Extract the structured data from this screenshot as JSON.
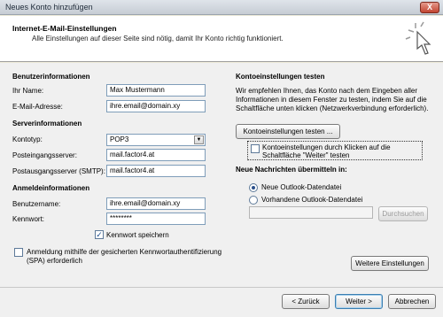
{
  "window": {
    "title": "Neues Konto hinzufügen",
    "close_glyph": "X"
  },
  "header": {
    "title": "Internet-E-Mail-Einstellungen",
    "description": "Alle Einstellungen auf dieser Seite sind nötig, damit Ihr Konto richtig funktioniert."
  },
  "user_info": {
    "heading": "Benutzerinformationen",
    "name_label": "Ihr Name:",
    "name_value": "Max Mustermann",
    "email_label": "E-Mail-Adresse:",
    "email_value": "ihre.email@domain.xy"
  },
  "server_info": {
    "heading": "Serverinformationen",
    "account_type_label": "Kontotyp:",
    "account_type_value": "POP3",
    "incoming_label": "Posteingangsserver:",
    "incoming_value": "mail.factor4.at",
    "outgoing_label": "Postausgangsserver (SMTP):",
    "outgoing_value": "mail.factor4.at"
  },
  "login_info": {
    "heading": "Anmeldeinformationen",
    "username_label": "Benutzername:",
    "username_value": "ihre.email@domain.xy",
    "password_label": "Kennwort:",
    "password_value": "********",
    "remember_label": "Kennwort speichern",
    "remember_checked": true,
    "spa_label_line1": "Anmeldung mithilfe der gesicherten Kennwortauthentifizierung",
    "spa_label_line2": "(SPA) erforderlich",
    "spa_checked": false
  },
  "test_settings": {
    "heading": "Kontoeinstellungen testen",
    "description_line1": "Wir empfehlen Ihnen, das Konto nach dem Eingeben aller",
    "description_line2": "Informationen in diesem Fenster zu testen, indem Sie auf die",
    "description_line3": "Schaltfläche unten klicken (Netzwerkverbindung erforderlich).",
    "test_button": "Kontoeinstellungen testen ...",
    "auto_test_line1": "Kontoeinstellungen durch Klicken auf die",
    "auto_test_line2": "Schaltfläche \"Weiter\" testen",
    "auto_test_checked": false
  },
  "delivery": {
    "heading": "Neue Nachrichten übermitteln in:",
    "option_new": "Neue Outlook-Datendatei",
    "option_existing": "Vorhandene Outlook-Datendatei",
    "selected": "new",
    "path_value": "",
    "browse_button": "Durchsuchen"
  },
  "more_settings_button": "Weitere Einstellungen",
  "nav": {
    "back": "< Zurück",
    "next": "Weiter >",
    "cancel": "Abbrechen"
  },
  "icons": {
    "header": "cursor-click-icon"
  }
}
